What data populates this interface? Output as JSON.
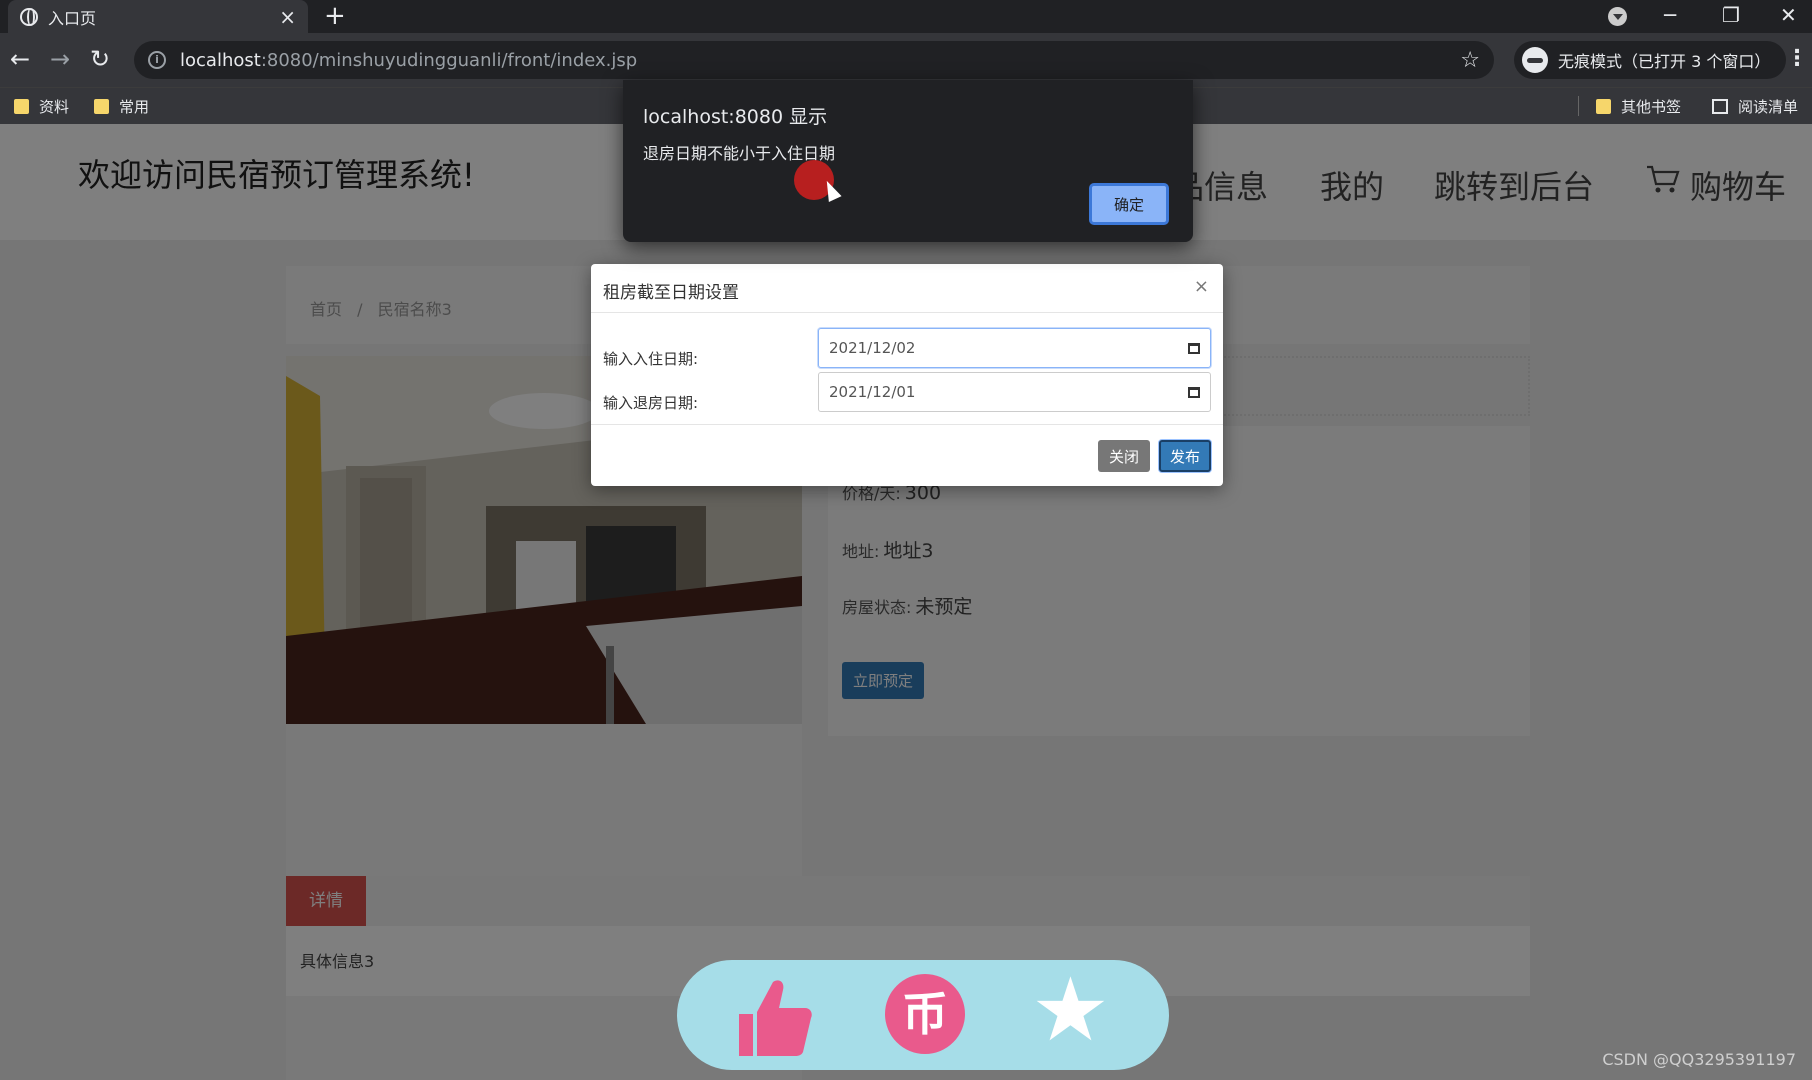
{
  "browser": {
    "tab_title": "入口页",
    "tab_close": "×",
    "new_tab": "+",
    "url_host": "localhost",
    "url_rest": ":8080/minshuyudingguanli/front/index.jsp",
    "incognito_label": "无痕模式（已打开 3 个窗口）",
    "bookmarks": [
      "资料",
      "常用"
    ],
    "other_bookmarks": "其他书签",
    "reading_list": "阅读清单"
  },
  "site": {
    "welcome": "欢迎访问民宿预订管理系统!",
    "nav": [
      "品信息",
      "我的",
      "跳转到后台",
      "购物车"
    ]
  },
  "breadcrumb": [
    "首页",
    "/",
    "民宿名称3"
  ],
  "listing": {
    "price_label": "价格/天:",
    "price_value": "300",
    "address_label": "地址:",
    "address_value": "地址3",
    "status_label": "房屋状态:",
    "status_value": "未预定",
    "reserve_button": "立即预定"
  },
  "details": {
    "tab": "详情",
    "text": "具体信息3"
  },
  "modal": {
    "title": "租房截至日期设置",
    "close_x": "×",
    "checkin_label": "输入入住日期:",
    "checkin_value": "2021/12/02",
    "checkout_label": "输入退房日期:",
    "checkout_value": "2021/12/01",
    "close_button": "关闭",
    "publish_button": "发布"
  },
  "alert": {
    "title": "localhost:8080 显示",
    "message": "退房日期不能小于入住日期",
    "ok_button": "确定"
  },
  "actions": {
    "coin_glyph": "币",
    "icons": [
      "thumbs-up-icon",
      "coin-icon",
      "star-icon"
    ],
    "thumb_color": "#e95a8c",
    "bar_color": "#a6dde8"
  },
  "watermark": "CSDN @QQ3295391197"
}
